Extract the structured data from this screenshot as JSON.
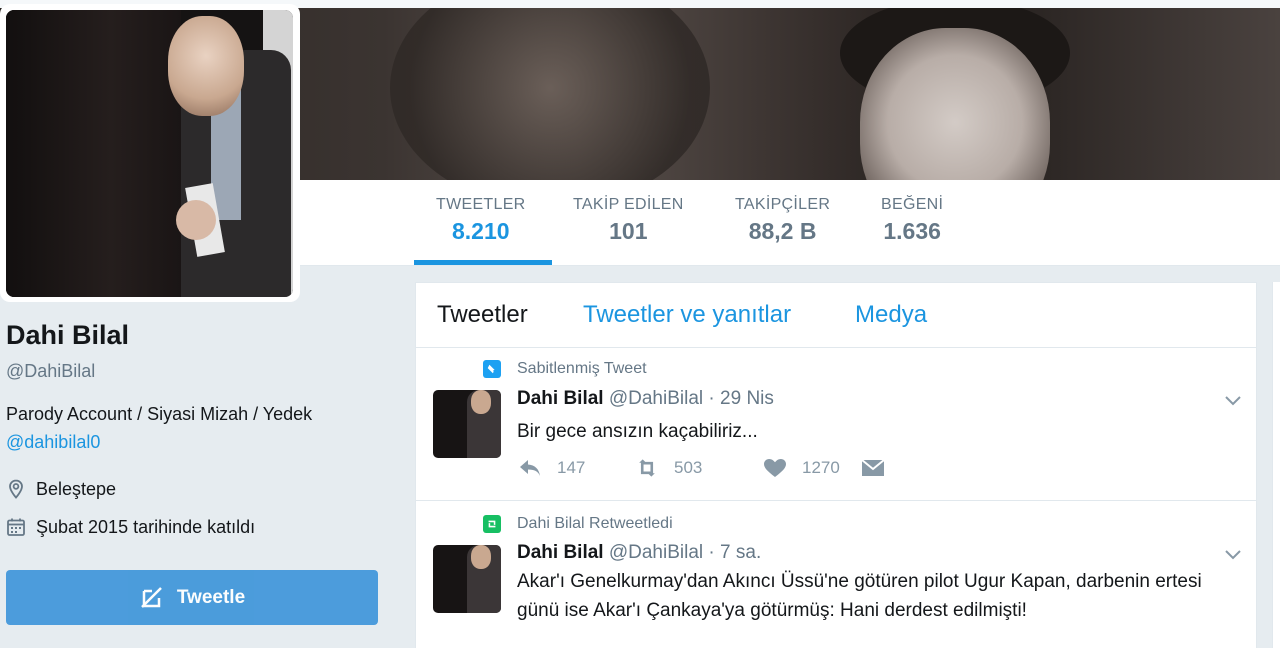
{
  "nav": {
    "items": [
      {
        "label": "TWEETLER",
        "value": "8.210"
      },
      {
        "label": "TAKİP EDİLEN",
        "value": "101"
      },
      {
        "label": "TAKİPÇİLER",
        "value": "88,2 B"
      },
      {
        "label": "BEĞENİ",
        "value": "1.636"
      }
    ],
    "active_color": "#1b95e0"
  },
  "profile": {
    "name": "Dahi Bilal",
    "handle": "@DahiBilal",
    "bio": "Parody Account / Siyasi Mizah / Yedek",
    "bio_link": "@dahibilal0",
    "location": "Beleştepe",
    "joined": "Şubat 2015 tarihinde katıldı",
    "tweet_button": "Tweetle"
  },
  "tabs": {
    "tweets": "Tweetler",
    "tweets_replies": "Tweetler ve yanıtlar",
    "media": "Medya"
  },
  "tweets": [
    {
      "context": "Sabitlenmiş Tweet",
      "context_icon": "pin-icon",
      "name": "Dahi Bilal",
      "handle": "@DahiBilal",
      "time": "· 29 Nis",
      "text": "Bir gece ansızın kaçabiliriz...",
      "replies": "147",
      "retweets": "503",
      "likes": "1270"
    },
    {
      "context": "Dahi Bilal Retweetledi",
      "context_icon": "retweet-icon",
      "name": "Dahi Bilal",
      "handle": "@DahiBilal",
      "time": "· 7 sa.",
      "text": "Akar'ı Genelkurmay'dan Akıncı Üssü'ne götüren pilot Ugur Kapan, darbenin ertesi günü ise Akar'ı Çankaya'ya götürmüş: Hani derdest edilmişti!"
    }
  ]
}
